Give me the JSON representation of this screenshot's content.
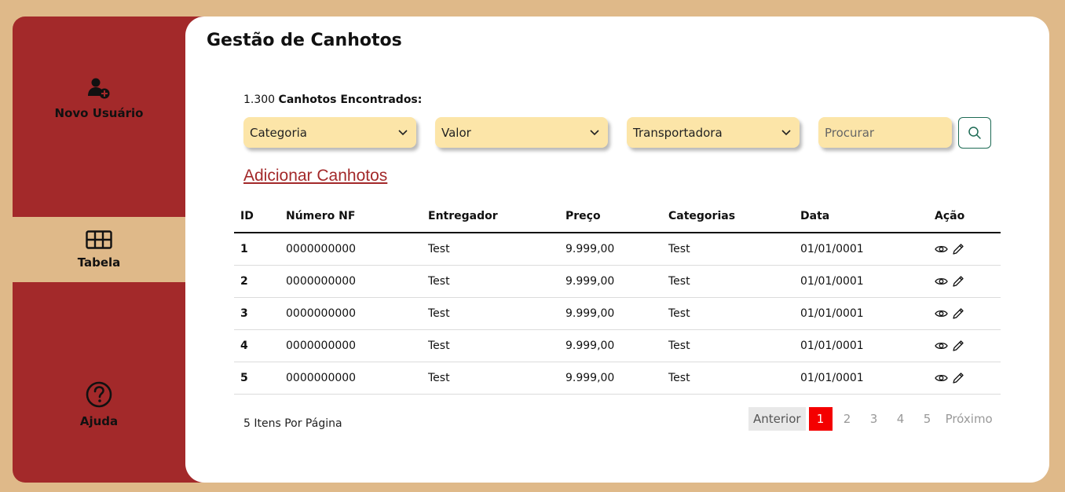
{
  "sidebar": {
    "items": [
      {
        "label": "Novo Usuário",
        "icon": "add-user-icon"
      },
      {
        "label": "Tabela",
        "icon": "table-icon"
      },
      {
        "label": "Ajuda",
        "icon": "help-icon"
      }
    ]
  },
  "header": {
    "title": "Gestão de Canhotos"
  },
  "results": {
    "count": "1.300",
    "count_label": "Canhotos Encontrados:"
  },
  "filters": {
    "category": "Categoria",
    "value": "Valor",
    "carrier": "Transportadora",
    "search_placeholder": "Procurar"
  },
  "add_link": "Adicionar Canhotos",
  "table": {
    "columns": [
      "ID",
      "Número NF",
      "Entregador",
      "Preço",
      "Categorias",
      "Data",
      "Ação"
    ],
    "rows": [
      [
        "1",
        "0000000000",
        "Test",
        "9.999,00",
        "Test",
        "01/01/0001"
      ],
      [
        "2",
        "0000000000",
        "Test",
        "9.999,00",
        "Test",
        "01/01/0001"
      ],
      [
        "3",
        "0000000000",
        "Test",
        "9.999,00",
        "Test",
        "01/01/0001"
      ],
      [
        "4",
        "0000000000",
        "Test",
        "9.999,00",
        "Test",
        "01/01/0001"
      ],
      [
        "5",
        "0000000000",
        "Test",
        "9.999,00",
        "Test",
        "01/01/0001"
      ]
    ]
  },
  "pagination": {
    "per_page": "5 Itens Por Página",
    "prev": "Anterior",
    "pages": [
      "1",
      "2",
      "3",
      "4",
      "5"
    ],
    "current": "1",
    "next": "Próximo"
  },
  "colors": {
    "sidebar": "#a3292a",
    "background": "#dfb989",
    "filter": "#fce5a8",
    "active_page": "#f40000",
    "accent_link": "#a3292a"
  }
}
